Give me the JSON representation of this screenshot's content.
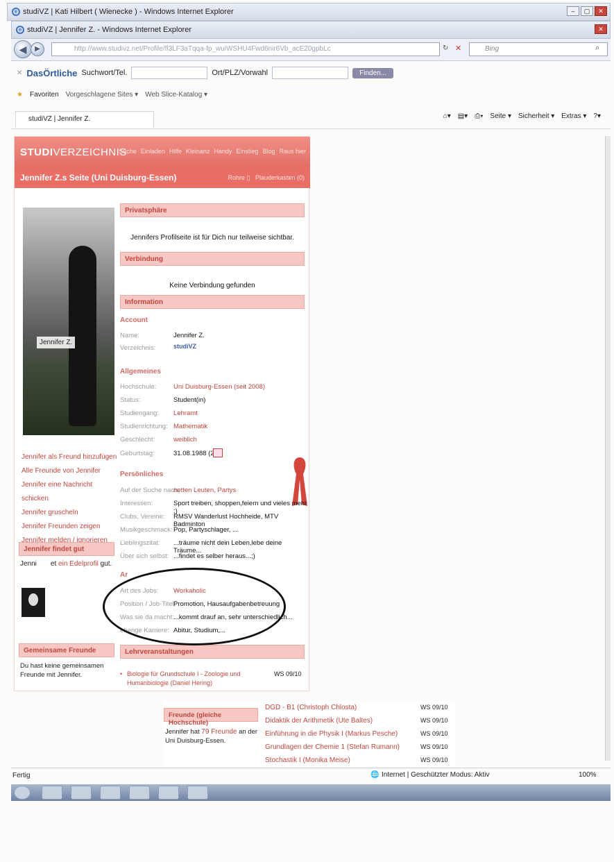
{
  "browser": {
    "back_window_title": "studiVZ | Kati Hilbert ( Wienecke ) - Windows Internet Explorer",
    "window_title": "studiVZ | Jennifer Z. - Windows Internet Explorer",
    "url": "http://www.studivz.net/Profile/fl3LF3aTqqa-fp_wuiWSHU4Fwd6nir6Vb_acE20gpbLc",
    "search_engine": "Bing",
    "tab_title": "studiVZ | Jennifer Z.",
    "favorites_label": "Favoriten",
    "suggested_sites": "Vorgeschlagene Sites ▾",
    "web_slice": "Web Slice-Katalog ▾",
    "cmd_page": "Seite ▾",
    "cmd_security": "Sicherheit ▾",
    "cmd_extras": "Extras ▾",
    "status_left": "Fertig",
    "status_zone": "Internet | Geschützter Modus: Aktiv",
    "zoom": "100%"
  },
  "toolbar": {
    "brand": "DasÖrtliche",
    "search_label": "Suchwort/Tel.",
    "location_label": "Ort/PLZ/Vorwahl",
    "find_button": "Finden..."
  },
  "site": {
    "logo_bold": "STUDI",
    "logo_rest": "VERZEICHNIS",
    "nav": [
      "Suche",
      "Einladen",
      "Hilfe",
      "Kleinanz",
      "Handy",
      "Einstieg",
      "Blog",
      "Raus hier"
    ],
    "page_title": "Jennifer Z.s Seite (Uni Duisburg-Essen)",
    "page_right_1": "Rohre",
    "page_right_2": "Plauderkasten (0)",
    "photo_tag": "Jennifer Z.",
    "actions": [
      "Jennifer als Freund hinzufügen",
      "Alle Freunde von Jennifer",
      "Jennifer eine Nachricht schicken",
      "Jennifer gruscheln",
      "Jennifer Freunden zeigen",
      "Jennifer melden / ignorieren"
    ],
    "findet_gut_title": "Jennifer findet gut",
    "findet_gut_pre": "Jenni",
    "findet_gut_mid": "et",
    "findet_gut_link": "ein Edelprofil",
    "findet_gut_post": "gut.",
    "gemeinsame_title": "Gemeinsame Freunde",
    "gemeinsame_text": "Du hast keine gemeinsamen Freunde mit Jennifer.",
    "privatsphaere_title": "Privatsphäre",
    "privatsphaere_text": "Jennifers Profilseite ist für Dich nur teilweise sichtbar.",
    "verbindung_title": "Verbindung",
    "verbindung_text": "Keine Verbindung gefunden",
    "information_title": "Information",
    "account_sub": "Account",
    "allgemeines_sub": "Allgemeines",
    "persoenliches_sub": "Persönliches",
    "arbeit_sub": "Ar",
    "rows_account": [
      {
        "label": "Name:",
        "value": "Jennifer Z.",
        "link": false
      },
      {
        "label": "Verzeichnis:",
        "value": "studiVZ",
        "link": true
      }
    ],
    "rows_allgemeines": [
      {
        "label": "Hochschule:",
        "value": "Uni Duisburg-Essen (seit 2008)",
        "link": true
      },
      {
        "label": "Status:",
        "value": "Student(in)",
        "link": false
      },
      {
        "label": "Studiengang:",
        "value": "Lehramt",
        "link": true
      },
      {
        "label": "Studienrichtung:",
        "value": "Mathematik",
        "link": true
      },
      {
        "label": "Geschlecht:",
        "value": "weiblich",
        "link": true
      },
      {
        "label": "Geburtstag:",
        "value": "31.08.1988 (21)",
        "link": false
      }
    ],
    "rows_persoenliches": [
      {
        "label": "Auf der Suche nach:",
        "value": "netten Leuten, Partys",
        "link": true
      },
      {
        "label": "Interessen:",
        "value": "Sport treiben, shoppen,feiern und vieles mehr ;)",
        "link": false
      },
      {
        "label": "Clubs, Vereine:",
        "value": "RMSV Wanderlust Hochheide, MTV Badminton",
        "link": false
      },
      {
        "label": "Musikgeschmack:",
        "value": "Pop, Partyschlager, ...",
        "link": false
      },
      {
        "label": "Lieblingszitat:",
        "value": "...träume nicht dein Leben,lebe deine Träume...",
        "link": false
      },
      {
        "label": "Über sich selbst:",
        "value": "...findet es selber heraus...;)",
        "link": false
      }
    ],
    "rows_arbeit": [
      {
        "label": "Art des Jobs:",
        "value": "Workaholic",
        "link": true
      },
      {
        "label": "Position / Job-Titel:",
        "value": "Promotion, Hausaufgabenbetreuung",
        "link": false
      },
      {
        "label": "Was sie da macht:",
        "value": "...kommt drauf an, sehr unterschiedlich...",
        "link": false
      },
      {
        "label": "ehenge Karriere:",
        "value": "Abitur, Studium,...",
        "link": false
      }
    ],
    "lehrveranstaltungen_title": "Lehrveranstaltungen",
    "courses": [
      {
        "title": "Biologie für Grundschule I - Zoologie und Humanbiologie (Daniel Hering)",
        "term": "WS 09/10"
      },
      {
        "title": "DGD - B1 (Christoph Chlosta)",
        "term": "WS 09/10"
      },
      {
        "title": "Didaktik der Arithmetik (Ute Baltes)",
        "term": "WS 09/10"
      },
      {
        "title": "Einführung in die Physik I (Markus Pesche)",
        "term": "WS 09/10"
      },
      {
        "title": "Grundlagen der Chemie 1 (Stefan Rumann)",
        "term": "WS 09/10"
      },
      {
        "title": "Stochastik I (Monika Meise)",
        "term": "WS 09/10"
      }
    ],
    "freunde_title": "Freunde (gleiche Hochschule)",
    "freunde_text_pre": "Jennifer hat",
    "freunde_link": "79 Freunde",
    "freunde_text_post": "an der Uni Duisburg-Essen."
  },
  "colors": {
    "accent": "#e86e66",
    "link": "#c0463e",
    "section_bg": "#f7c8c3"
  }
}
